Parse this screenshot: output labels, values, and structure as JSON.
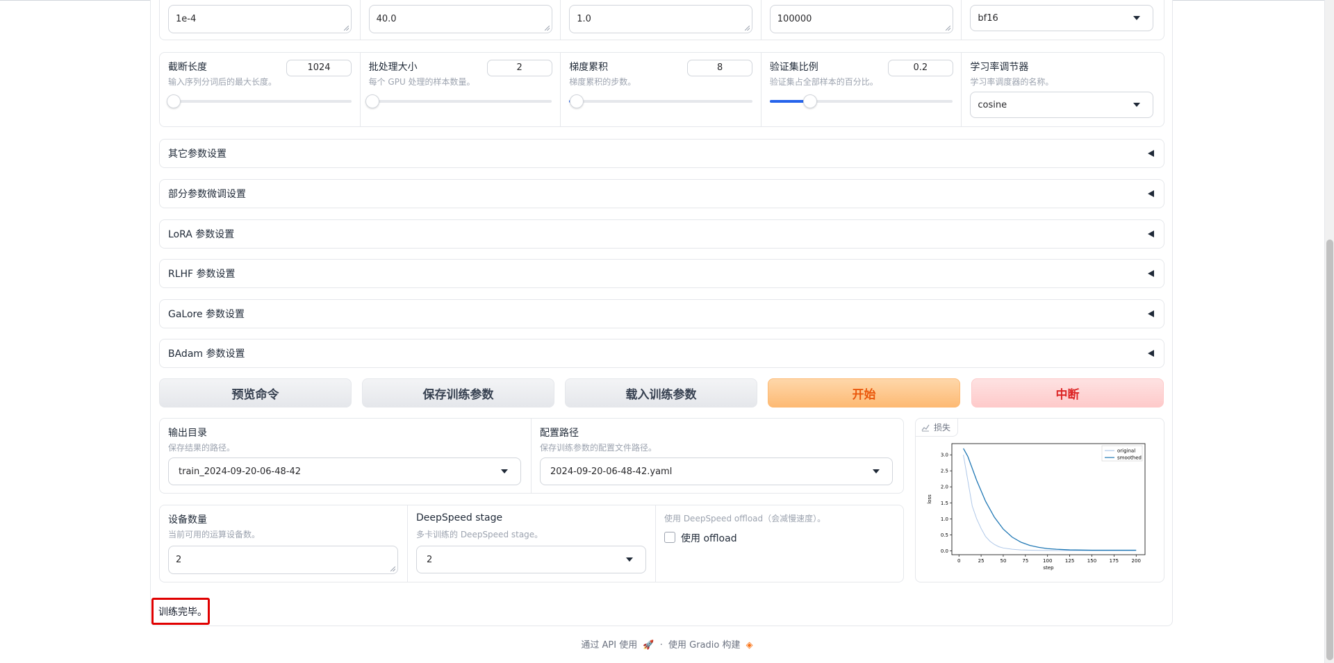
{
  "top_row": {
    "learning_rate": "1e-4",
    "epochs": "40.0",
    "max_grad_norm": "1.0",
    "max_samples": "100000",
    "compute_type": "bf16"
  },
  "param_row": [
    {
      "label": "截断长度",
      "info": "输入序列分词后的最大长度。",
      "value": "1024",
      "slider_fraction": 0.03
    },
    {
      "label": "批处理大小",
      "info": "每个 GPU 处理的样本数量。",
      "value": "2",
      "slider_fraction": 0.0
    },
    {
      "label": "梯度累积",
      "info": "梯度累积的步数。",
      "value": "8",
      "slider_fraction": 0.04
    },
    {
      "label": "验证集比例",
      "info": "验证集占全部样本的百分比。",
      "value": "0.2",
      "slider_fraction": 0.22
    }
  ],
  "lr_scheduler": {
    "label": "学习率调节器",
    "info": "学习率调度器的名称。",
    "value": "cosine"
  },
  "accordions": [
    "其它参数设置",
    "部分参数微调设置",
    "LoRA 参数设置",
    "RLHF 参数设置",
    "GaLore 参数设置",
    "BAdam 参数设置"
  ],
  "buttons": {
    "preview": "预览命令",
    "save": "保存训练参数",
    "load": "载入训练参数",
    "start": "开始",
    "stop": "中断"
  },
  "output_dir": {
    "label": "输出目录",
    "info": "保存结果的路径。",
    "value": "train_2024-09-20-06-48-42"
  },
  "config_path": {
    "label": "配置路径",
    "info": "保存训练参数的配置文件路径。",
    "value": "2024-09-20-06-48-42.yaml"
  },
  "device_count": {
    "label": "设备数量",
    "info": "当前可用的运算设备数。",
    "value": "2"
  },
  "ds_stage": {
    "label": "DeepSpeed stage",
    "info": "多卡训练的 DeepSpeed stage。",
    "value": "2"
  },
  "ds_offload": {
    "info": "使用 DeepSpeed offload（会减慢速度）。",
    "checkbox_label": "使用 offload",
    "checked": false
  },
  "plot_label": "损失",
  "status_text": "训练完毕。",
  "footer": {
    "api": "通过 API 使用",
    "sep": "·",
    "built": "使用 Gradio 构建"
  },
  "chart_data": {
    "type": "line",
    "xlabel": "step",
    "ylabel": "loss",
    "xlim": [
      -8,
      210
    ],
    "ylim": [
      -0.12,
      3.35
    ],
    "xticks": [
      0,
      25,
      50,
      75,
      100,
      125,
      150,
      175,
      200
    ],
    "yticks": [
      0.0,
      0.5,
      1.0,
      1.5,
      2.0,
      2.5,
      3.0
    ],
    "legend_position": "top-right",
    "series": [
      {
        "name": "original",
        "color": "#aec7e8",
        "x": [
          5,
          10,
          15,
          20,
          25,
          30,
          35,
          40,
          45,
          50,
          60,
          70,
          80,
          90,
          100,
          120,
          150,
          175,
          200
        ],
        "y": [
          3.0,
          2.2,
          1.4,
          1.0,
          0.7,
          0.45,
          0.3,
          0.2,
          0.13,
          0.09,
          0.05,
          0.03,
          0.02,
          0.015,
          0.012,
          0.01,
          0.01,
          0.01,
          0.01
        ]
      },
      {
        "name": "smoothed",
        "color": "#1f77b4",
        "x": [
          5,
          10,
          20,
          30,
          40,
          50,
          60,
          70,
          80,
          90,
          100,
          110,
          125,
          150,
          175,
          200
        ],
        "y": [
          3.2,
          2.95,
          2.2,
          1.55,
          1.05,
          0.68,
          0.43,
          0.27,
          0.17,
          0.11,
          0.07,
          0.05,
          0.03,
          0.02,
          0.02,
          0.02
        ]
      }
    ]
  }
}
